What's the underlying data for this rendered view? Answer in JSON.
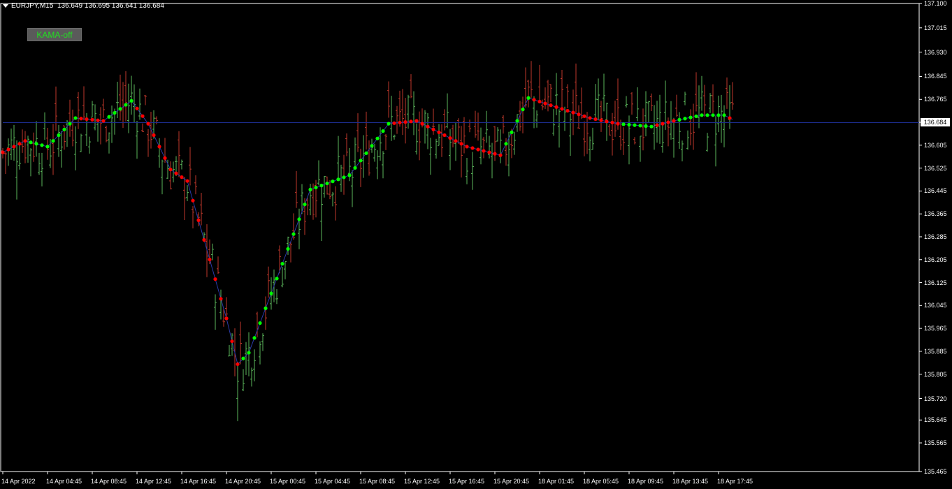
{
  "header": {
    "symbol": "EURJPY,M15",
    "ohlc": "136.649 136.695 136.641 136.684"
  },
  "button": {
    "label": "KAMA-off"
  },
  "current_price": "136.684",
  "colors": {
    "background": "#000000",
    "axis": "#ffffff",
    "grid": "#1a2a3a",
    "bull_bar": "#5cb85c",
    "bear_bar": "#c0392b",
    "kama_up": "#00ff00",
    "kama_down": "#ff0000",
    "price_line": "#1c2c8c"
  },
  "chart_data": {
    "type": "ohlc-bars-with-indicator",
    "title": "EURJPY,M15",
    "indicator_name": "KAMA",
    "ylim": [
      135.465,
      137.1
    ],
    "y_ticks": [
      "137.100",
      "137.015",
      "136.930",
      "136.845",
      "136.765",
      "136.685",
      "136.605",
      "136.525",
      "136.445",
      "136.365",
      "136.285",
      "136.205",
      "136.125",
      "136.045",
      "135.965",
      "135.885",
      "135.805",
      "135.720",
      "135.645",
      "135.565",
      "135.465"
    ],
    "x_ticks": [
      "14 Apr 2022",
      "14 Apr 04:45",
      "14 Apr 08:45",
      "14 Apr 12:45",
      "14 Apr 16:45",
      "14 Apr 20:45",
      "15 Apr 00:45",
      "15 Apr 04:45",
      "15 Apr 08:45",
      "15 Apr 12:45",
      "15 Apr 16:45",
      "15 Apr 20:45",
      "18 Apr 01:45",
      "18 Apr 05:45",
      "18 Apr 09:45",
      "18 Apr 13:45",
      "18 Apr 17:45"
    ],
    "kama_keypoints": [
      [
        0,
        136.58,
        "up"
      ],
      [
        8,
        136.62,
        "down"
      ],
      [
        16,
        136.6,
        "up"
      ],
      [
        26,
        136.7,
        "up"
      ],
      [
        36,
        136.69,
        "down"
      ],
      [
        46,
        136.76,
        "up"
      ],
      [
        52,
        136.68,
        "down"
      ],
      [
        60,
        136.52,
        "down"
      ],
      [
        66,
        136.48,
        "down"
      ],
      [
        80,
        136.0,
        "down"
      ],
      [
        84,
        135.84,
        "down"
      ],
      [
        88,
        135.88,
        "up"
      ],
      [
        110,
        136.45,
        "up"
      ],
      [
        124,
        136.5,
        "up"
      ],
      [
        138,
        136.68,
        "up"
      ],
      [
        148,
        136.69,
        "down"
      ],
      [
        166,
        136.6,
        "down"
      ],
      [
        178,
        136.57,
        "down"
      ],
      [
        188,
        136.77,
        "up"
      ],
      [
        210,
        136.7,
        "down"
      ],
      [
        220,
        136.68,
        "down"
      ],
      [
        232,
        136.67,
        "up"
      ],
      [
        240,
        136.69,
        "down"
      ],
      [
        250,
        136.71,
        "up"
      ],
      [
        258,
        136.71,
        "up"
      ],
      [
        262,
        136.69,
        "down"
      ]
    ],
    "bars_count": 262
  }
}
